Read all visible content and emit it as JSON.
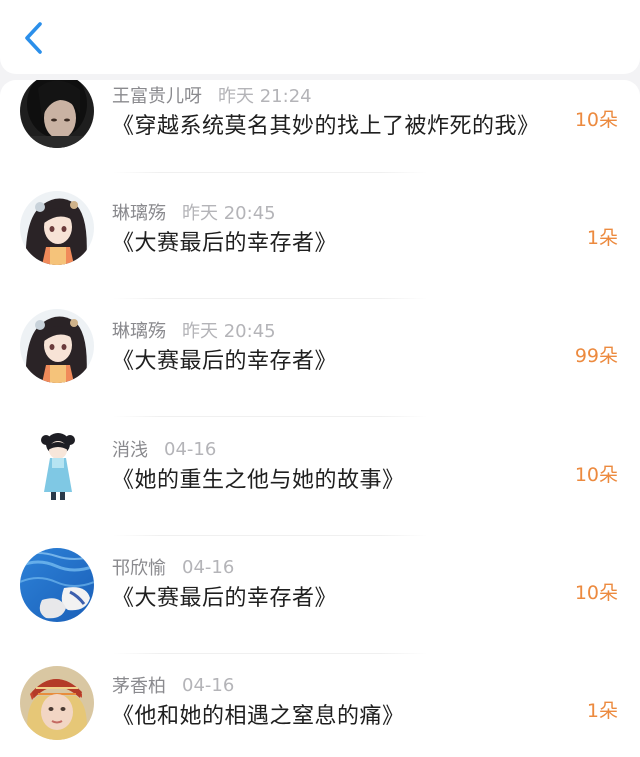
{
  "header": {
    "back_icon": "chevron-left-icon",
    "accent_color": "#2b8fea"
  },
  "gift_color": "#ec8a3f",
  "records": [
    {
      "name": "王富贵儿呀",
      "time": "昨天 21:24",
      "title": "《穿越系统莫名其妙的找上了被炸死的我》",
      "gift": "10朵",
      "avatar": "dark-portrait"
    },
    {
      "name": "琳璃殇",
      "time": "昨天 20:45",
      "title": "《大赛最后的幸存者》",
      "gift": "1朵",
      "avatar": "anime-girl"
    },
    {
      "name": "琳璃殇",
      "time": "昨天 20:45",
      "title": "《大赛最后的幸存者》",
      "gift": "99朵",
      "avatar": "anime-girl"
    },
    {
      "name": "消浅",
      "time": "04-16",
      "title": "《她的重生之他与她的故事》",
      "gift": "10朵",
      "avatar": "chibi-girl"
    },
    {
      "name": "邗欣愉",
      "time": "04-16",
      "title": "《大赛最后的幸存者》",
      "gift": "10朵",
      "avatar": "pool-slippers"
    },
    {
      "name": "茅香柏",
      "time": "04-16",
      "title": "《他和她的相遇之窒息的痛》",
      "gift": "1朵",
      "avatar": "headscarf-woman"
    }
  ]
}
